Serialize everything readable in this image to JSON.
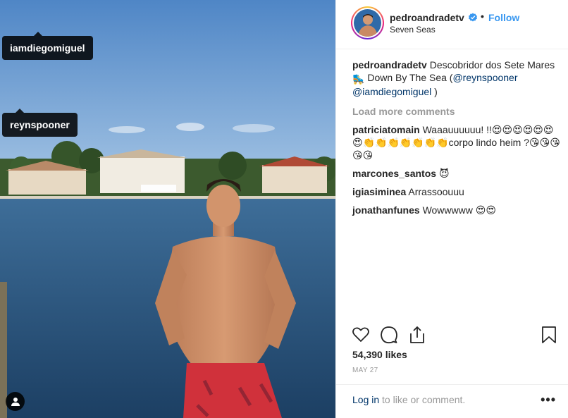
{
  "photo": {
    "tags": [
      {
        "username": "iamdiegomiguel"
      },
      {
        "username": "reynspooner"
      }
    ],
    "user_tag_icon": "person-icon"
  },
  "header": {
    "username": "pedroandradetv",
    "verified_icon": "verified-badge-icon",
    "separator": "•",
    "follow_label": "Follow",
    "location": "Seven Seas"
  },
  "caption": {
    "username": "pedroandradetv",
    "text": "Descobridor dos Sete Mares",
    "emoji": "🛼",
    "text2": "Down By The Sea (",
    "mention1": "@reynspooner",
    "mention2": "@iamdiegomiguel",
    "close": ")"
  },
  "load_more_label": "Load more comments",
  "comments": [
    {
      "username": "patriciatomain",
      "text": "Waaauuuuuu! !!😍😍😍😍😍😍😍👏👏👏👏👏👏👏corpo lindo heim ?😘😘😘😘😘"
    },
    {
      "username": "marcones_santos",
      "text": "😈"
    },
    {
      "username": "igiasiminea",
      "text": "Arrassoouuu"
    },
    {
      "username": "jonathanfunes",
      "text": "Wowwwww 😍😍"
    }
  ],
  "actions": {
    "like_icon": "heart-icon",
    "comment_icon": "comment-icon",
    "share_icon": "share-icon",
    "save_icon": "bookmark-icon"
  },
  "likes": "54,390 likes",
  "date": "MAY 27",
  "footer": {
    "login_link": "Log in",
    "login_rest": " to like or comment.",
    "more": "•••"
  },
  "colors": {
    "link_blue": "#3897f0",
    "mention_blue": "#003569",
    "muted": "#999999",
    "text": "#262626"
  }
}
